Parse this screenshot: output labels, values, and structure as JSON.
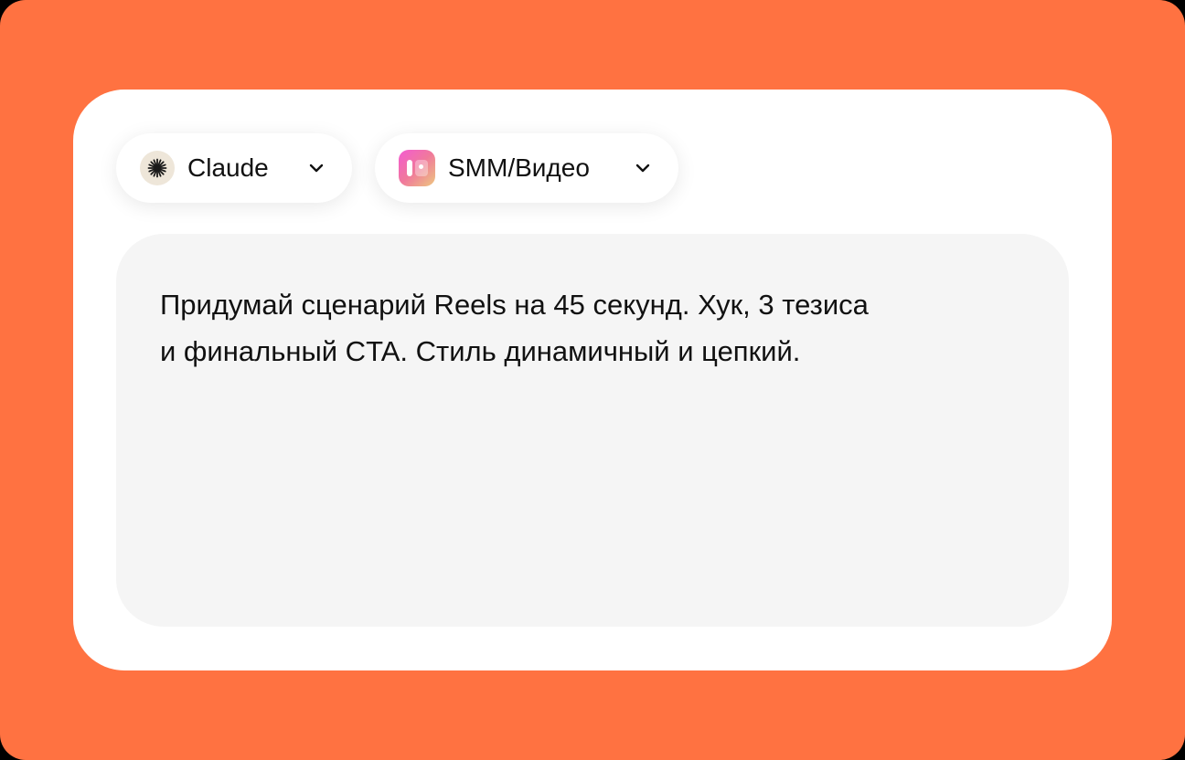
{
  "model_selector": {
    "label": "Claude",
    "icon": "claude-asterisk-icon",
    "chevron_icon": "chevron-down-icon"
  },
  "category_selector": {
    "label": "SMM/Видео",
    "icon": "smm-video-icon",
    "chevron_icon": "chevron-down-icon"
  },
  "prompt": {
    "text": "Придумай сценарий Reels на 45 секунд. Хук, 3 тезиса\nи финальный CTA. Стиль динамичный и цепкий."
  },
  "colors": {
    "background": "#FF7241",
    "card": "#FFFFFF",
    "prompt_box": "#F5F5F5",
    "text": "#111111"
  }
}
